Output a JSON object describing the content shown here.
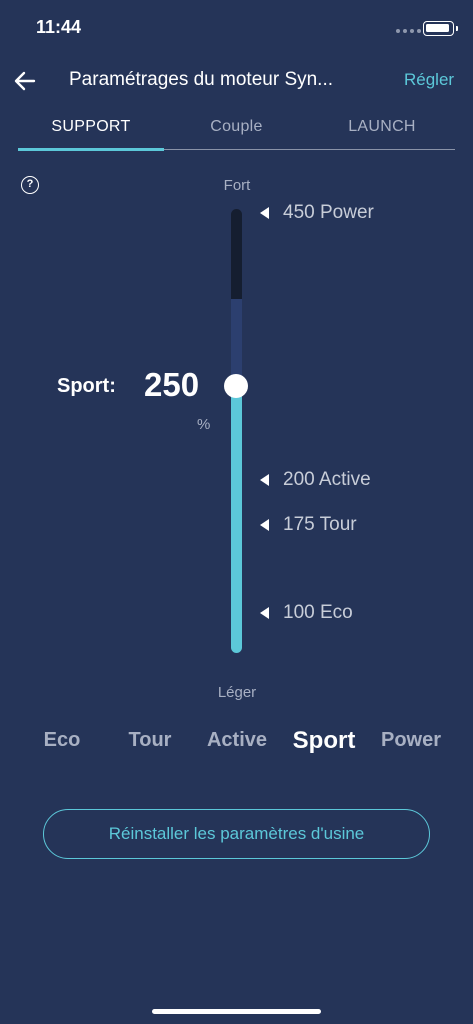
{
  "status_bar": {
    "time": "11:44"
  },
  "header": {
    "title": "Paramétrages du moteur Syn...",
    "action_label": "Régler"
  },
  "tabs": [
    {
      "label": "SUPPORT",
      "active": true
    },
    {
      "label": "Couple",
      "active": false
    },
    {
      "label": "LAUNCH",
      "active": false
    }
  ],
  "help": {
    "glyph": "?"
  },
  "slider": {
    "top_label": "Fort",
    "bottom_label": "Léger",
    "current_mode_label": "Sport:",
    "current_value": "250",
    "unit": "%",
    "markers": [
      {
        "label": "450 Power"
      },
      {
        "label": "200 Active"
      },
      {
        "label": "175 Tour"
      },
      {
        "label": "100 Eco"
      }
    ]
  },
  "modes": [
    {
      "label": "Eco",
      "selected": false
    },
    {
      "label": "Tour",
      "selected": false
    },
    {
      "label": "Active",
      "selected": false
    },
    {
      "label": "Sport",
      "selected": true
    },
    {
      "label": "Power",
      "selected": false
    }
  ],
  "reset_button": {
    "label": "Réinstaller les paramètres d'usine"
  },
  "colors": {
    "background": "#253458",
    "accent": "#5cc8d9",
    "muted_text": "#a8b0c3"
  },
  "icons": {
    "back": "arrow-left-icon",
    "help": "question-circle-icon",
    "battery": "battery-icon",
    "signal": "signal-dots-icon"
  }
}
